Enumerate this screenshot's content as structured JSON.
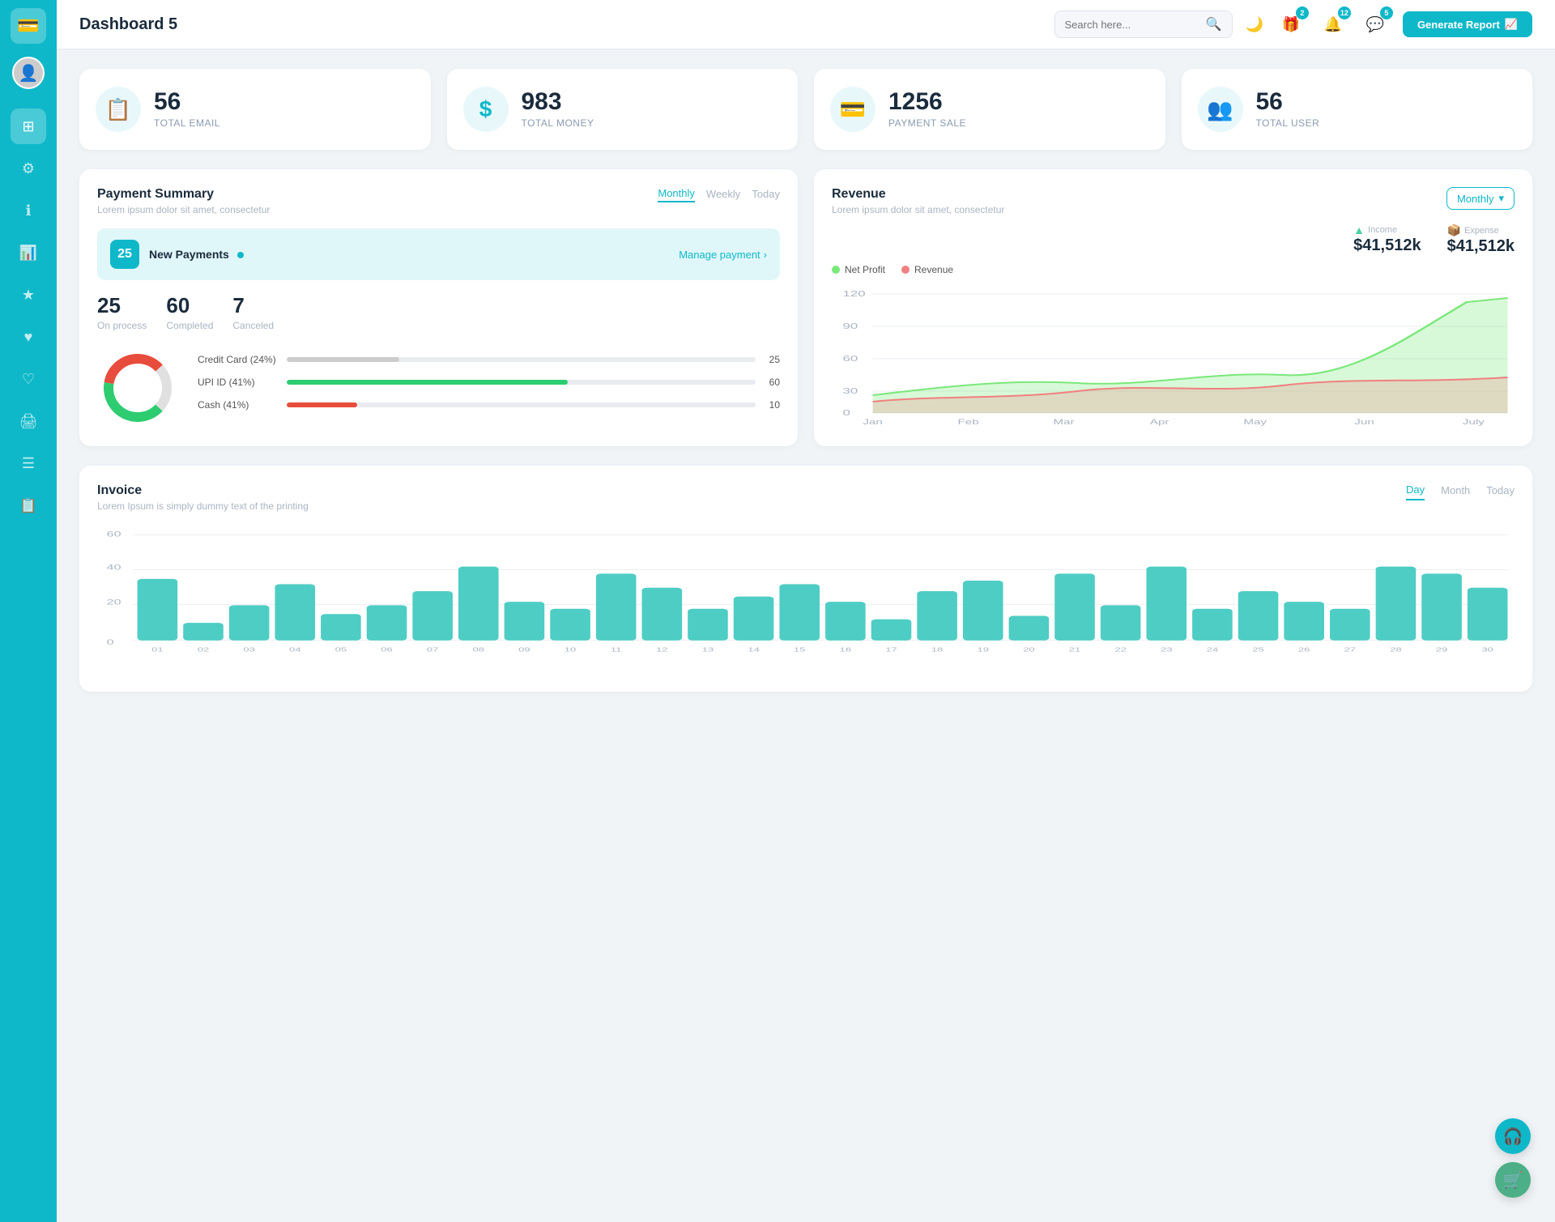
{
  "sidebar": {
    "logo_icon": "💳",
    "items": [
      {
        "id": "dashboard",
        "icon": "⊞",
        "active": true
      },
      {
        "id": "settings",
        "icon": "⚙"
      },
      {
        "id": "info",
        "icon": "ℹ"
      },
      {
        "id": "chart",
        "icon": "📊"
      },
      {
        "id": "star",
        "icon": "★"
      },
      {
        "id": "heart-solid",
        "icon": "♥"
      },
      {
        "id": "heart-outline",
        "icon": "♡"
      },
      {
        "id": "print",
        "icon": "🖨"
      },
      {
        "id": "list",
        "icon": "☰"
      },
      {
        "id": "document",
        "icon": "📋"
      }
    ]
  },
  "header": {
    "title": "Dashboard 5",
    "search_placeholder": "Search here...",
    "generate_btn": "Generate Report",
    "badges": {
      "gift": "2",
      "bell": "12",
      "chat": "5"
    }
  },
  "stat_cards": [
    {
      "id": "email",
      "icon": "📋",
      "number": "56",
      "label": "TOTAL EMAIL"
    },
    {
      "id": "money",
      "icon": "$",
      "number": "983",
      "label": "TOTAL MONEY"
    },
    {
      "id": "payment",
      "icon": "💳",
      "number": "1256",
      "label": "PAYMENT SALE"
    },
    {
      "id": "user",
      "icon": "👥",
      "number": "56",
      "label": "TOTAL USER"
    }
  ],
  "payment_summary": {
    "title": "Payment Summary",
    "subtitle": "Lorem ipsum dolor sit amet, consectetur",
    "tabs": [
      "Monthly",
      "Weekly",
      "Today"
    ],
    "active_tab": "Monthly",
    "new_payments_count": "25",
    "new_payments_label": "New Payments",
    "manage_link": "Manage payment",
    "stats": [
      {
        "label": "On process",
        "value": "25"
      },
      {
        "label": "Completed",
        "value": "60"
      },
      {
        "label": "Canceled",
        "value": "7"
      }
    ],
    "progress_items": [
      {
        "label": "Credit Card (24%)",
        "value": 24,
        "max": 100,
        "color": "#ccc",
        "count": "25"
      },
      {
        "label": "UPI ID (41%)",
        "value": 41,
        "max": 100,
        "color": "#2ecc71",
        "count": "60"
      },
      {
        "label": "Cash (41%)",
        "value": 15,
        "max": 100,
        "color": "#e74c3c",
        "count": "10"
      }
    ],
    "donut": {
      "segments": [
        {
          "color": "#e0e0e0",
          "pct": 24
        },
        {
          "color": "#2ecc71",
          "pct": 41
        },
        {
          "color": "#e74c3c",
          "pct": 35
        }
      ]
    }
  },
  "revenue": {
    "title": "Revenue",
    "subtitle": "Lorem ipsum dolor sit amet, consectetur",
    "dropdown": "Monthly",
    "income": {
      "label": "Income",
      "value": "$41,512k"
    },
    "expense": {
      "label": "Expense",
      "value": "$41,512k"
    },
    "legend": [
      {
        "label": "Net Profit",
        "color": "#7be87b"
      },
      {
        "label": "Revenue",
        "color": "#f08080"
      }
    ],
    "x_labels": [
      "Jan",
      "Feb",
      "Mar",
      "Apr",
      "May",
      "Jun",
      "July"
    ],
    "y_labels": [
      "0",
      "30",
      "60",
      "90",
      "120"
    ]
  },
  "invoice": {
    "title": "Invoice",
    "subtitle": "Lorem Ipsum is simply dummy text of the printing",
    "tabs": [
      "Day",
      "Month",
      "Today"
    ],
    "active_tab": "Day",
    "x_labels": [
      "01",
      "02",
      "03",
      "04",
      "05",
      "06",
      "07",
      "08",
      "09",
      "10",
      "11",
      "12",
      "13",
      "14",
      "15",
      "16",
      "17",
      "18",
      "19",
      "20",
      "21",
      "22",
      "23",
      "24",
      "25",
      "26",
      "27",
      "28",
      "29",
      "30"
    ],
    "y_labels": [
      "0",
      "20",
      "40",
      "60"
    ],
    "bars": [
      35,
      10,
      20,
      32,
      15,
      20,
      28,
      42,
      22,
      18,
      38,
      30,
      18,
      25,
      32,
      22,
      12,
      28,
      34,
      14,
      38,
      20,
      42,
      18,
      28,
      22,
      18,
      42,
      38,
      30
    ]
  },
  "fab": [
    {
      "id": "support",
      "icon": "🎧",
      "color": "#0eb8c9"
    },
    {
      "id": "cart",
      "icon": "🛒",
      "color": "#4caf87"
    }
  ]
}
